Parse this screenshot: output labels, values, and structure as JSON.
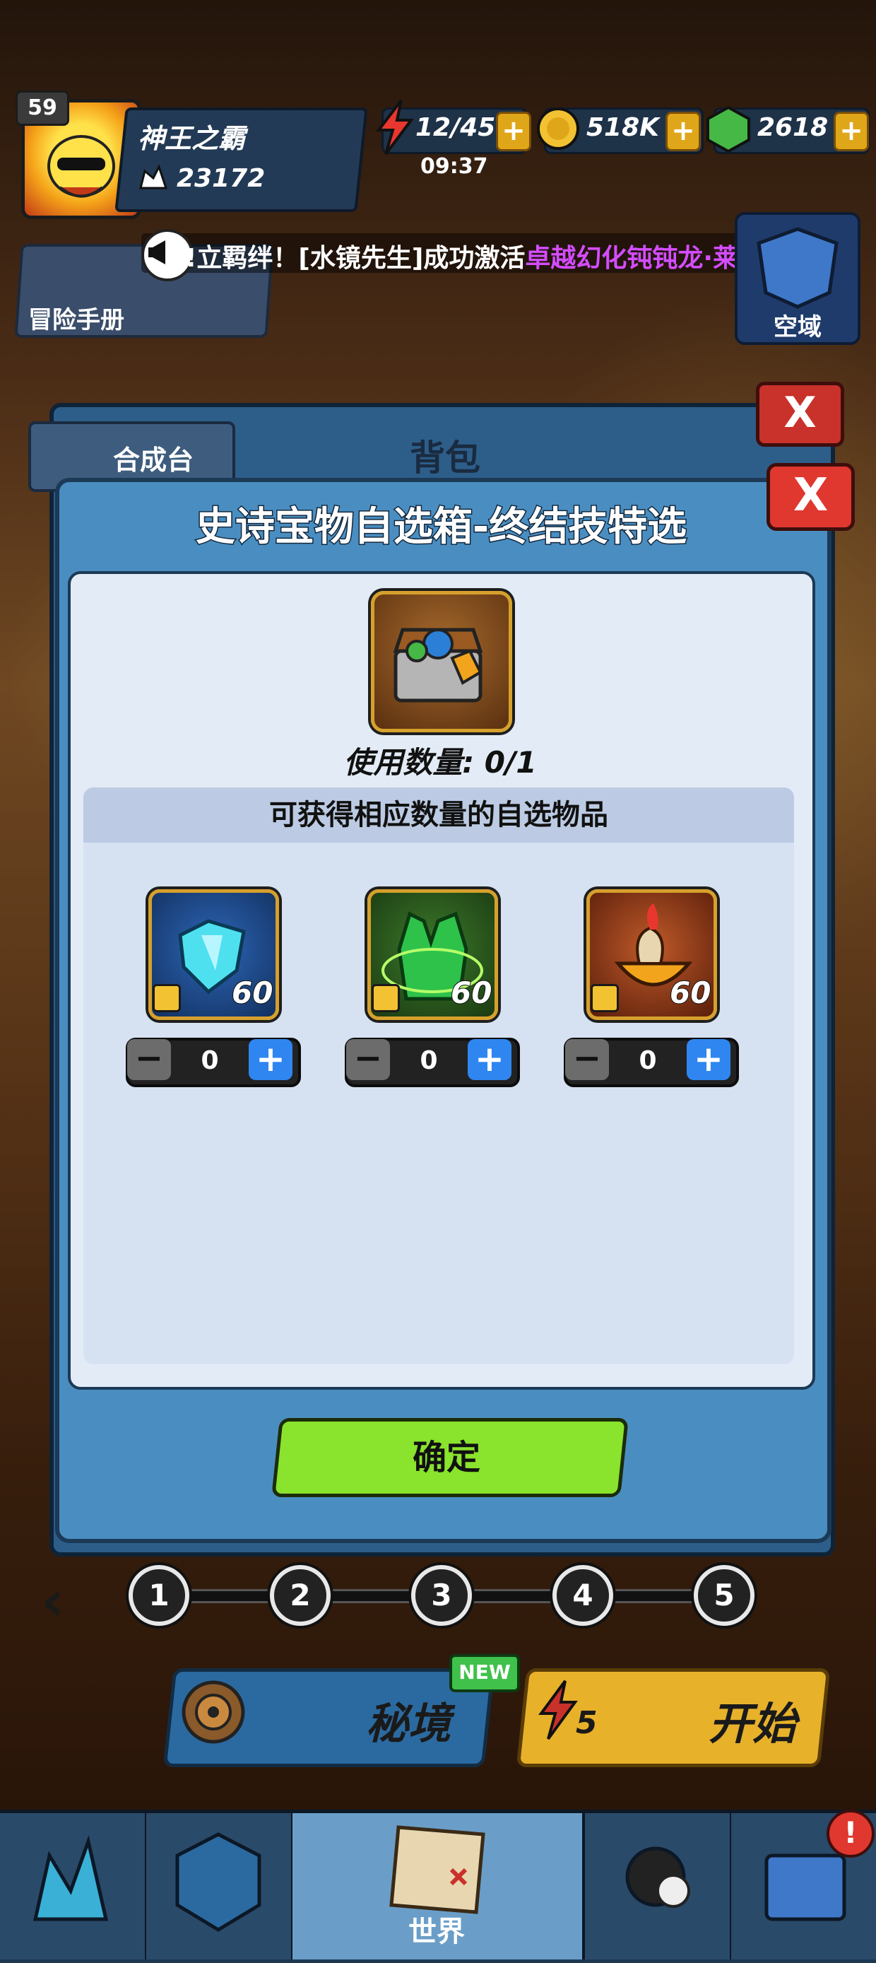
{
  "player": {
    "level": "59",
    "name": "神王之霸",
    "power": "23172"
  },
  "resources": {
    "energy": "12/45",
    "energy_timer": "09:37",
    "gold": "518K",
    "gems": "2618",
    "plus": "+"
  },
  "announcement": {
    "prefix": "!立羁绊！[水镜先生]成功激活",
    "highlight": "卓越幻化钝钝龙·莱"
  },
  "side_buttons": {
    "adventure_book": "冒险手册",
    "kongyu": "空域"
  },
  "bag": {
    "title": "背包",
    "craft_tab": "合成台",
    "close": "X"
  },
  "modal": {
    "title": "史诗宝物自选箱-终结技特选",
    "close": "X",
    "use_count": "使用数量: 0/1",
    "subheader": "可获得相应数量的自选物品",
    "items": [
      {
        "icon": "crystal-heart-icon",
        "count": "60",
        "qty": "0"
      },
      {
        "icon": "green-vest-icon",
        "count": "60",
        "qty": "0"
      },
      {
        "icon": "fire-bowl-icon",
        "count": "60",
        "qty": "0"
      }
    ],
    "minus": "−",
    "plus": "+",
    "confirm": "确定"
  },
  "pager": {
    "pages": [
      "1",
      "2",
      "3",
      "4",
      "5"
    ]
  },
  "actions": {
    "secret": "秘境",
    "new_badge": "NEW",
    "start": "开始",
    "start_cost": "5"
  },
  "nav": {
    "world": "世界",
    "alert": "!"
  },
  "colors": {
    "confirm": "#8ae32c",
    "plus_button": "#2f86f0",
    "close": "#e0372e",
    "highlight": "#d44cff"
  }
}
